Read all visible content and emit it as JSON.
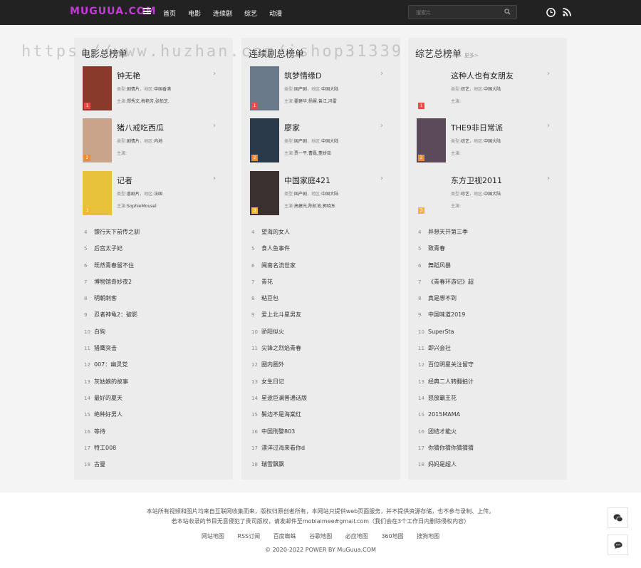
{
  "header": {
    "logo": "MUGUUA.COM",
    "nav": [
      "首页",
      "电影",
      "连续剧",
      "综艺",
      "动漫"
    ],
    "search_placeholder": "搜索片"
  },
  "watermark": "https://www.huzhan.com/ishop31339",
  "meta_labels": {
    "type": "类型:",
    "area": "地区:",
    "cast": "主演:"
  },
  "columns": [
    {
      "title": "电影总榜单",
      "more": "",
      "top": [
        {
          "rank": "1",
          "name": "钟无艳",
          "type": "剧情片",
          "area": "中国香港",
          "cast": "郑秀文,梅艳芳,张柏芝,",
          "poster": "#8a3a2a"
        },
        {
          "rank": "2",
          "name": "猪八戒吃西瓜",
          "type": "剧情片",
          "area": "内地",
          "cast": "",
          "poster": "#c9a48a"
        },
        {
          "rank": "3",
          "name": "记者",
          "type": "喜剧片",
          "area": "法国",
          "cast": "SophieMousel",
          "poster": "#e8c23a"
        }
      ],
      "list": [
        {
          "rank": "4",
          "name": "镖行天下前传之驯"
        },
        {
          "rank": "5",
          "name": "后宫太子妃"
        },
        {
          "rank": "6",
          "name": "既然青春留不住"
        },
        {
          "rank": "7",
          "name": "博物馆奇妙夜2"
        },
        {
          "rank": "8",
          "name": "明朝刺客"
        },
        {
          "rank": "9",
          "name": "忍者神龟2：破影"
        },
        {
          "rank": "10",
          "name": "白狗"
        },
        {
          "rank": "11",
          "name": "猎鹰突击"
        },
        {
          "rank": "12",
          "name": "007：幽灵党"
        },
        {
          "rank": "13",
          "name": "灰姑娘的故事"
        },
        {
          "rank": "14",
          "name": "最好的夏天"
        },
        {
          "rank": "15",
          "name": "绝种好男人"
        },
        {
          "rank": "16",
          "name": "等待"
        },
        {
          "rank": "17",
          "name": "特工008"
        },
        {
          "rank": "18",
          "name": "古曼"
        }
      ]
    },
    {
      "title": "连续剧总榜单",
      "more": "",
      "top": [
        {
          "rank": "1",
          "name": "筑梦情缘D",
          "type": "国产剧",
          "area": "中国大陆",
          "cast": "霍建华,杨幂,曾江,冯雷",
          "poster": "#6a7a8a"
        },
        {
          "rank": "2",
          "name": "廖家",
          "type": "国产剧",
          "area": "中国大陆",
          "cast": "贾一平,曹磊,董娇茹",
          "poster": "#2a3a4a"
        },
        {
          "rank": "3",
          "name": "中国家庭421",
          "type": "国产剧",
          "area": "中国大陆",
          "cast": "高建光,陈虹池,郭晓东",
          "poster": "#3a3030"
        }
      ],
      "list": [
        {
          "rank": "4",
          "name": "望海的女人"
        },
        {
          "rank": "5",
          "name": "食人鱼事件"
        },
        {
          "rank": "6",
          "name": "闽南名流世家"
        },
        {
          "rank": "7",
          "name": "青花"
        },
        {
          "rank": "8",
          "name": "粘豆包"
        },
        {
          "rank": "9",
          "name": "爱上北斗星男友"
        },
        {
          "rank": "10",
          "name": "骄阳似火"
        },
        {
          "rank": "11",
          "name": "尖锋之烈焰青春"
        },
        {
          "rank": "12",
          "name": "圈内圈外"
        },
        {
          "rank": "13",
          "name": "女生日记"
        },
        {
          "rank": "14",
          "name": "星途巨澜普通话版"
        },
        {
          "rank": "15",
          "name": "鬓边不是海棠红"
        },
        {
          "rank": "16",
          "name": "中国刑警803"
        },
        {
          "rank": "17",
          "name": "漂洋过海来看你d"
        },
        {
          "rank": "18",
          "name": "瑞雪飘飘"
        }
      ]
    },
    {
      "title": "综艺总榜单",
      "more": "更多>",
      "top": [
        {
          "rank": "1",
          "name": "这种人也有女朋友",
          "type": "综艺",
          "area": "中国大陆",
          "cast": "",
          "poster": ""
        },
        {
          "rank": "2",
          "name": "THE9非日常派",
          "type": "综艺",
          "area": "中国大陆",
          "cast": "",
          "poster": "#5a4a5a"
        },
        {
          "rank": "3",
          "name": "东方卫视2011",
          "type": "综艺",
          "area": "中国大陆",
          "cast": "",
          "poster": ""
        }
      ],
      "list": [
        {
          "rank": "4",
          "name": "异想天开第三季"
        },
        {
          "rank": "5",
          "name": "致青春"
        },
        {
          "rank": "6",
          "name": "舞蹈风暴"
        },
        {
          "rank": "7",
          "name": "《青春环游记》超"
        },
        {
          "rank": "8",
          "name": "真是想不到"
        },
        {
          "rank": "9",
          "name": "中国味道2019"
        },
        {
          "rank": "10",
          "name": "SuperSta"
        },
        {
          "rank": "11",
          "name": "即兴会社"
        },
        {
          "rank": "12",
          "name": "百位明星关注留守"
        },
        {
          "rank": "13",
          "name": "经典二人转翻拍计"
        },
        {
          "rank": "14",
          "name": "怒放霸王花"
        },
        {
          "rank": "15",
          "name": "2015MAMA"
        },
        {
          "rank": "16",
          "name": "团结才能火"
        },
        {
          "rank": "17",
          "name": "你猜你猜你猜猜猜"
        },
        {
          "rank": "18",
          "name": "妈妈是超人"
        }
      ]
    }
  ],
  "rank_colors": {
    "1": "#e84a4a",
    "2": "#f08a2a",
    "3": "#f5b82a"
  },
  "footer": {
    "disclaimer1": "本站所有视频和图片均来自互联网收集而来，版权归原创者所有，本网站只提供web页面服务，并不提供资源存储，也不参与录制、上传。",
    "disclaimer2": "若本站收录的节目无意侵犯了贵司版权，请发邮件至mobiaimee#gmail.com（我们会在3个工作日内删除侵权内容）",
    "links": [
      "网站地图",
      "RSS订阅",
      "百度蜘蛛",
      "谷歌地图",
      "必应地图",
      "360地图",
      "搜狗地图"
    ],
    "copyright": "© 2020-2022 POWER BY MuGuua.COM"
  }
}
